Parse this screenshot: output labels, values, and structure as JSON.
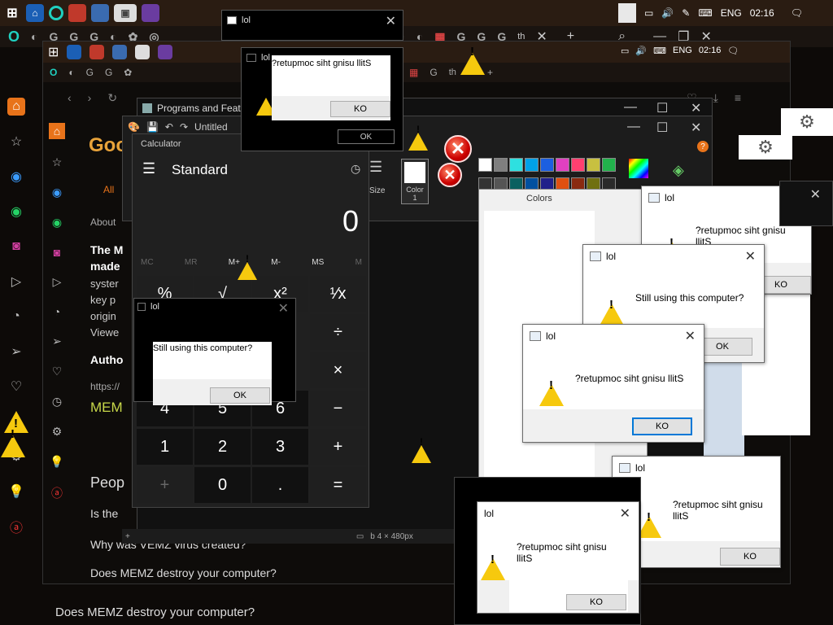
{
  "taskbar": {
    "lang": "ENG",
    "time": "02:16",
    "tab_title": "th"
  },
  "inner_taskbar": {
    "lang": "ENG",
    "time": "02:16",
    "tab_title": "th"
  },
  "inner_tab": {
    "title": "th"
  },
  "programs_window": {
    "title": "Programs and Features"
  },
  "paint": {
    "title": "Untitled",
    "size_label": "Size",
    "color1_label": "Color\n1",
    "palette": [
      "#000000",
      "#7f7f7f",
      "#880015",
      "#ed1c24",
      "#ff7f27",
      "#fff200",
      "#22b14c",
      "#00a2e8",
      "#3f48cc",
      "#a349a4",
      "#ffffff",
      "#c3c3c3",
      "#b97a57",
      "#ffaec9",
      "#ffc90e",
      "#efe4b0",
      "#b5e61d",
      "#99d9ea",
      "#7092be",
      "#c8bfe7"
    ]
  },
  "calculator": {
    "title": "Calculator",
    "mode": "Standard",
    "display": "0",
    "memory": [
      "MC",
      "MR",
      "M+",
      "M-",
      "MS",
      "M"
    ],
    "row1": [
      "%",
      "√",
      "x²",
      "¹⁄x"
    ],
    "row2_ops": [
      "÷",
      "×",
      "−",
      "+",
      "="
    ],
    "digits_row": [
      "4",
      "5",
      "6"
    ],
    "digits_row2": [
      "1",
      "2",
      "3"
    ],
    "bottom": [
      "+",
      "0",
      "."
    ]
  },
  "google": {
    "logo": "Goo",
    "tab_all": "All",
    "about": "About",
    "bold_line1": "The M",
    "bold_line2": "made",
    "lines": [
      "syster",
      "key p",
      "origin",
      "Viewe"
    ],
    "author": "Autho",
    "https": "https://",
    "memz": "MEM",
    "people": "Peop",
    "q1": "Is the",
    "q2": "Why was VEMZ virus created?",
    "q3": "Does MEMZ destroy your computer?",
    "q4": "Does MEMZ destroy your computer?"
  },
  "colors_dialog": {
    "title": "Colors"
  },
  "status_bar": {
    "dims": "b 4 × 480px"
  },
  "dialogs": [
    {
      "title": "lol",
      "message": "?retupmoc siht gnisu llitS",
      "button": "KO"
    },
    {
      "title": "lol",
      "message": "?retupmoc siht gnisu llitS",
      "button": "OK"
    },
    {
      "title": "lol",
      "message": "Still using this computer?",
      "button": "OK"
    },
    {
      "title": "lol",
      "message": "?retupmoc siht gnisu llitS",
      "button": "KO"
    },
    {
      "title": "lol",
      "message": "Still using this computer?",
      "button": "OK"
    },
    {
      "title": "lol",
      "message": "?retupmoc siht gnisu llitS",
      "button": "KO"
    },
    {
      "title": "lol",
      "message": "?retupmoc siht gnisu llitS",
      "button": "KO"
    },
    {
      "title": "lol",
      "message": "?retupmoc siht gnisu llitS",
      "button": "KO"
    },
    {
      "title": "lol",
      "message": "Still using this computer?",
      "button": "OK"
    },
    {
      "title": "lol",
      "message": "",
      "button": ""
    },
    {
      "title": "lol",
      "message": "",
      "button": ""
    },
    {
      "title": "lol",
      "message": "",
      "button": ""
    }
  ],
  "colors": {
    "accent_orange": "#e8731a",
    "warning_yellow": "#f6c90e",
    "error_red": "#cc0000"
  }
}
